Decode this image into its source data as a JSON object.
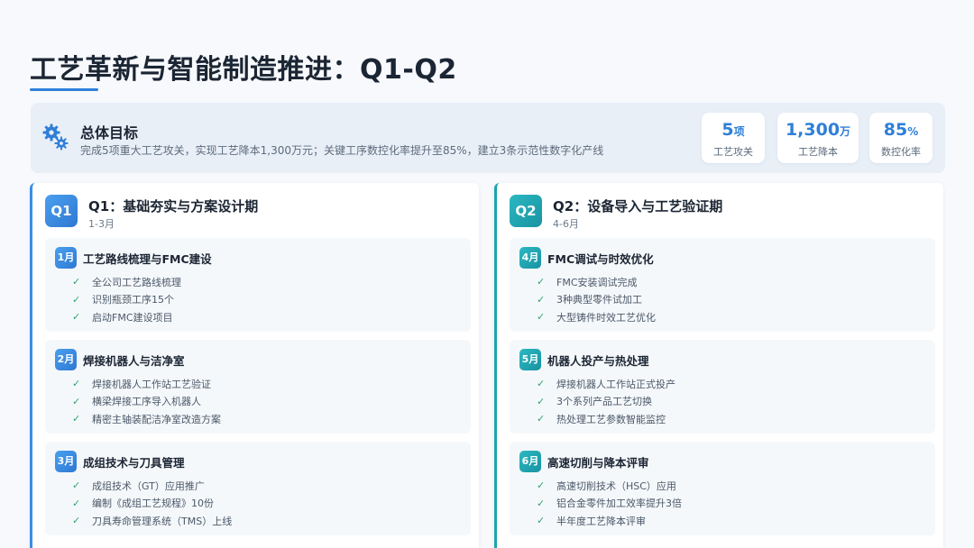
{
  "page": {
    "title": "工艺革新与智能制造推进：Q1-Q2"
  },
  "goal": {
    "icon": "gear-icon",
    "title": "总体目标",
    "description": "完成5项重大工艺攻关，实现工艺降本1,300万元；关键工序数控化率提升至85%，建立3条示范性数字化产线",
    "stats": [
      {
        "value": "5",
        "unit": "项",
        "label": "工艺攻关"
      },
      {
        "value": "1,300",
        "unit": "万",
        "label": "工艺降本"
      },
      {
        "value": "85",
        "unit": "%",
        "label": "数控化率"
      }
    ]
  },
  "quarters": [
    {
      "badge": "Q1",
      "title": "Q1：基础夯实与方案设计期",
      "subtitle": "1-3月",
      "months": [
        {
          "badge": "1月",
          "title": "工艺路线梳理与FMC建设",
          "items": [
            "全公司工艺路线梳理",
            "识别瓶颈工序15个",
            "启动FMC建设项目"
          ]
        },
        {
          "badge": "2月",
          "title": "焊接机器人与洁净室",
          "items": [
            "焊接机器人工作站工艺验证",
            "横梁焊接工序导入机器人",
            "精密主轴装配洁净室改造方案"
          ]
        },
        {
          "badge": "3月",
          "title": "成组技术与刀具管理",
          "items": [
            "成组技术（GT）应用推广",
            "编制《成组工艺规程》10份",
            "刀具寿命管理系统（TMS）上线"
          ]
        }
      ]
    },
    {
      "badge": "Q2",
      "title": "Q2：设备导入与工艺验证期",
      "subtitle": "4-6月",
      "months": [
        {
          "badge": "4月",
          "title": "FMC调试与时效优化",
          "items": [
            "FMC安装调试完成",
            "3种典型零件试加工",
            "大型铸件时效工艺优化"
          ]
        },
        {
          "badge": "5月",
          "title": "机器人投产与热处理",
          "items": [
            "焊接机器人工作站正式投产",
            "3个系列产品工艺切换",
            "热处理工艺参数智能监控"
          ]
        },
        {
          "badge": "6月",
          "title": "高速切削与降本评审",
          "items": [
            "高速切削技术（HSC）应用",
            "铝合金零件加工效率提升3倍",
            "半年度工艺降本评审"
          ]
        }
      ]
    }
  ]
}
